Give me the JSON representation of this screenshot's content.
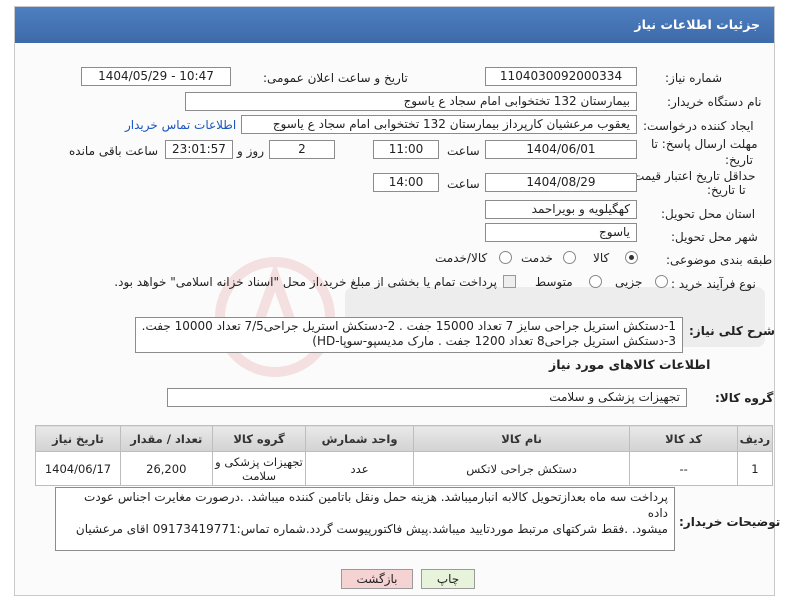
{
  "header": {
    "title": "جزئیات اطلاعات نیاز"
  },
  "fields": {
    "need_number_label": "شماره نیاز:",
    "need_number": "1104030092000334",
    "announce_label": "تاریخ و ساعت اعلان عمومی:",
    "announce_value": "1404/05/29 - 10:47",
    "buyer_label": "نام دستگاه خریدار:",
    "buyer_value": "بیمارستان 132 تختخوابی امام سجاد  ع  یاسوج",
    "creator_label": "ایجاد کننده درخواست:",
    "creator_value": "یعقوب مرعشیان کارپرداز بیمارستان 132 تختخوابی امام سجاد  ع  یاسوج",
    "contact_link": "اطلاعات تماس خریدار",
    "deadline_label_1": "مهلت ارسال پاسخ: تا",
    "deadline_label_2": "تاریخ:",
    "deadline_date": "1404/06/01",
    "time_label": "ساعت",
    "deadline_time": "11:00",
    "days_count": "2",
    "days_label": "روز و",
    "remaining_time": "23:01:57",
    "remaining_label": "ساعت باقی مانده",
    "validity_label_1": "حداقل تاریخ اعتبار قیمت:",
    "validity_label_2": "تا تاریخ:",
    "validity_date": "1404/08/29",
    "validity_time": "14:00",
    "province_label": "استان محل تحویل:",
    "province_value": "کهگیلویه و بویراحمد",
    "city_label": "شهر محل تحویل:",
    "city_value": "یاسوج",
    "category_label": "طبقه بندی موضوعی:",
    "category_options": [
      "کالا",
      "خدمت",
      "کالا/خدمت"
    ],
    "process_label": "نوع فرآیند خرید :",
    "process_options": [
      "جزیی",
      "متوسط"
    ],
    "payment_note": "پرداخت تمام یا بخشی از مبلغ خرید،از محل \"اسناد خزانه اسلامی\" خواهد بود."
  },
  "description": {
    "label": "شرح کلی نیاز:",
    "line1": "1-دستکش استریل جراحی سایز 7 تعداد 15000 جفت .  2-دستکش استریل جراحی7/5 تعداد 10000 جفت.",
    "line2": "3-دستکش استریل جراحی8 تعداد 1200 جفت . مارک مدیسپو-سوپا-HD)"
  },
  "goods": {
    "section_title": "اطلاعات کالاهای مورد نیاز",
    "group_label": "گروه کالا:",
    "group_value": "تجهیزات پزشکی و سلامت",
    "columns": [
      "ردیف",
      "کد کالا",
      "نام کالا",
      "واحد شمارش",
      "گروه کالا",
      "تعداد / مقدار",
      "تاریخ نیاز"
    ],
    "rows": [
      {
        "row": "1",
        "code": "--",
        "name": "دستکش جراحی لاتکس",
        "unit": "عدد",
        "group": "تجهیزات پزشکی و سلامت",
        "qty": "26,200",
        "date": "1404/06/17"
      }
    ]
  },
  "buyer_notes": {
    "label": "توضیحات خریدار:",
    "line1": "پرداخت سه ماه بعدازتحویل کالابه انبارمیباشد. هزینه حمل ونقل باتامین کننده میباشد. .درصورت مغایرت اجناس عودت داده",
    "line2": "میشود. .فقط شرکتهای مرتبط موردتایید میباشد.پیش فاکتورپیوست گردد.شماره تماس:09173419771 اقای مرعشیان"
  },
  "buttons": {
    "print": "چاپ",
    "back": "بازگشت"
  },
  "colors": {
    "header": "#4e7fc0",
    "back_button": "#f6d3d3",
    "print_button": "#e8f3dc",
    "link": "#1a55c0"
  }
}
